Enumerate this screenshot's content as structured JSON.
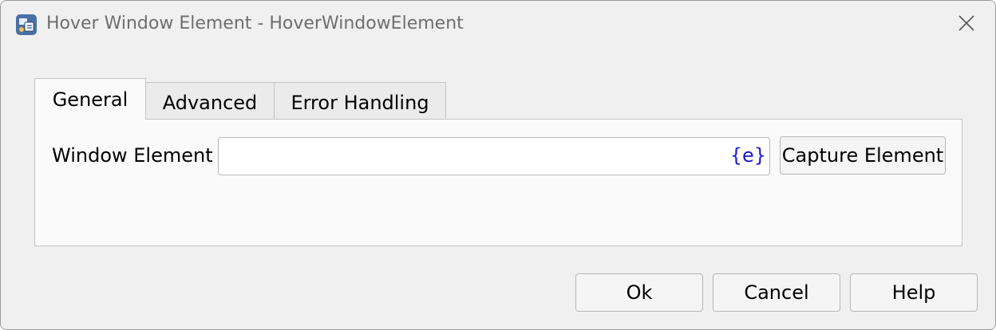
{
  "window": {
    "title": "Hover Window Element - HoverWindowElement",
    "app_icon": "automation-action-icon",
    "close_icon": "close-icon"
  },
  "tabs": [
    {
      "label": "General",
      "active": true
    },
    {
      "label": "Advanced",
      "active": false
    },
    {
      "label": "Error Handling",
      "active": false
    }
  ],
  "general": {
    "window_element_label": "Window Element",
    "window_element_value": "",
    "variable_token": "{e}",
    "capture_button": "Capture Element"
  },
  "footer": {
    "ok": "Ok",
    "cancel": "Cancel",
    "help": "Help"
  },
  "colors": {
    "variable_token": "#1a1acc",
    "title_text": "#6e6e6e"
  }
}
